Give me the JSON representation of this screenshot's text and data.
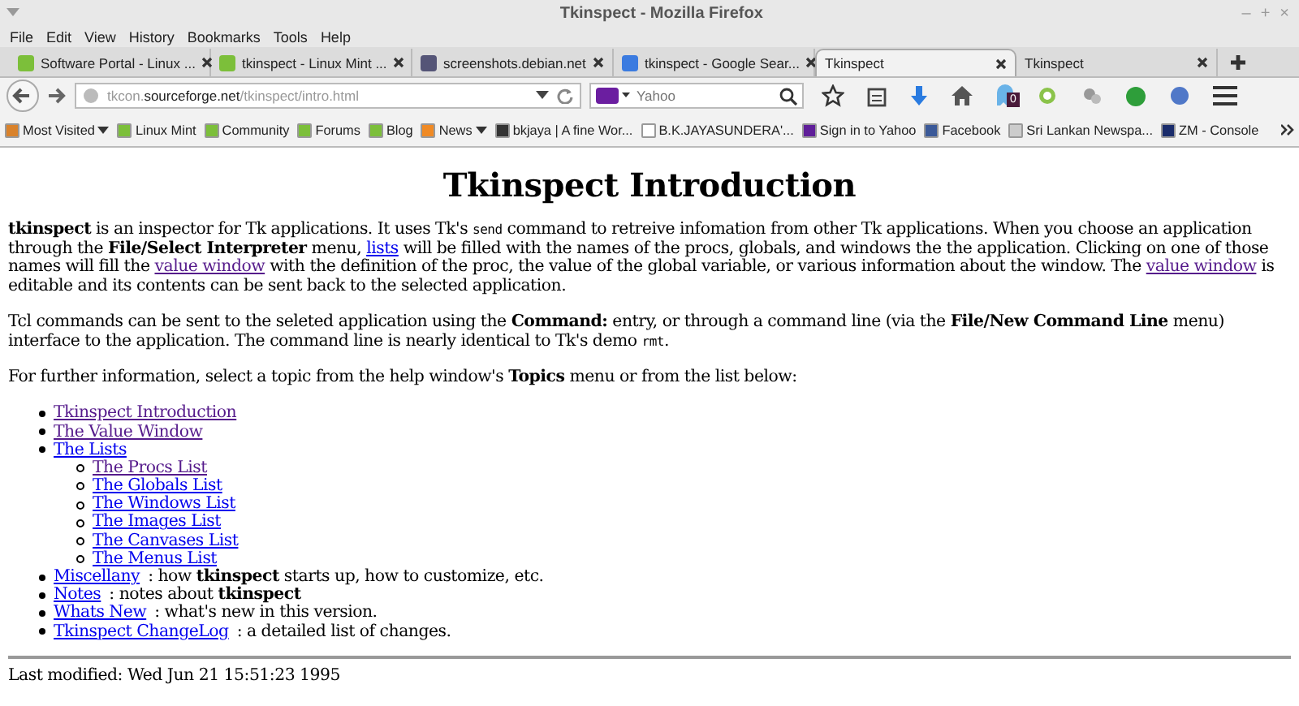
{
  "window": {
    "title": "Tkinspect - Mozilla Firefox",
    "controls": [
      "–",
      "+",
      "×"
    ]
  },
  "menu": [
    "File",
    "Edit",
    "View",
    "History",
    "Bookmarks",
    "Tools",
    "Help"
  ],
  "tabs": [
    {
      "label": "Software Portal - Linux ...",
      "kind": "mint",
      "selected": false
    },
    {
      "label": "tkinspect - Linux Mint ...",
      "kind": "mint",
      "selected": false
    },
    {
      "label": "screenshots.debian.net",
      "kind": "screen",
      "selected": false
    },
    {
      "label": "tkinspect - Google Sear...",
      "kind": "google",
      "selected": false
    },
    {
      "label": "Tkinspect",
      "kind": "plain",
      "selected": true
    },
    {
      "label": "Tkinspect",
      "kind": "plain",
      "selected": false
    }
  ],
  "address": {
    "parts": [
      {
        "text": "tkcon.",
        "emphasis": false
      },
      {
        "text": "sourceforge.net",
        "emphasis": true
      },
      {
        "text": "/tkinspect/intro.html",
        "emphasis": false
      }
    ]
  },
  "search": {
    "placeholder": "Yahoo"
  },
  "toolbar": {
    "badge": "0"
  },
  "bookmarks": [
    {
      "label": "Most Visited",
      "kind": "folder",
      "dropdown": true
    },
    {
      "label": "Linux Mint",
      "kind": "mint",
      "dropdown": false
    },
    {
      "label": "Community",
      "kind": "mint",
      "dropdown": false
    },
    {
      "label": "Forums",
      "kind": "mint",
      "dropdown": false
    },
    {
      "label": "Blog",
      "kind": "mint",
      "dropdown": false
    },
    {
      "label": "News",
      "kind": "rss",
      "dropdown": true
    },
    {
      "label": "bkjaya | A fine Wor...",
      "kind": "dark",
      "dropdown": false
    },
    {
      "label": "B.K.JAYASUNDERA'...",
      "kind": "page",
      "dropdown": false
    },
    {
      "label": "Sign in to Yahoo",
      "kind": "yahoo",
      "dropdown": false
    },
    {
      "label": "Facebook",
      "kind": "facebook",
      "dropdown": false
    },
    {
      "label": "Sri Lankan Newspa...",
      "kind": "news",
      "dropdown": false
    },
    {
      "label": "ZM - Console",
      "kind": "zm",
      "dropdown": false
    }
  ],
  "page": {
    "heading": "Tkinspect Introduction",
    "paragraphs": [
      [
        {
          "kind": "bold",
          "text": "tkinspect"
        },
        {
          "kind": "text",
          "text": " is an inspector for Tk applications. It uses Tk's "
        },
        {
          "kind": "code",
          "text": "send"
        },
        {
          "kind": "text",
          "text": " command to retreive infomation from other Tk applications. When you choose an application through the "
        },
        {
          "kind": "bold",
          "text": "File/Select Interpreter"
        },
        {
          "kind": "text",
          "text": " menu, "
        },
        {
          "kind": "link",
          "text": "lists",
          "visited": false
        },
        {
          "kind": "text",
          "text": " will be filled with the names of the procs, globals, and windows the the application. Clicking on one of those names will fill the "
        },
        {
          "kind": "link",
          "text": "value window",
          "visited": true
        },
        {
          "kind": "text",
          "text": " with the definition of the proc, the value of the global variable, or various information about the window. The "
        },
        {
          "kind": "link",
          "text": "value window",
          "visited": true
        },
        {
          "kind": "text",
          "text": " is editable and its contents can be sent back to the selected application."
        }
      ],
      [
        {
          "kind": "text",
          "text": "Tcl commands can be sent to the seleted application using the "
        },
        {
          "kind": "bold",
          "text": "Command:"
        },
        {
          "kind": "text",
          "text": " entry, or through a command line (via the "
        },
        {
          "kind": "bold",
          "text": "File/New Command Line"
        },
        {
          "kind": "text",
          "text": " menu) interface to the application. The command line is nearly identical to Tk's demo "
        },
        {
          "kind": "code",
          "text": "rmt"
        },
        {
          "kind": "text",
          "text": "."
        }
      ],
      [
        {
          "kind": "text",
          "text": "For further information, select a topic from the help window's "
        },
        {
          "kind": "bold",
          "text": "Topics"
        },
        {
          "kind": "text",
          "text": " menu or from the list below:"
        }
      ]
    ],
    "topics": [
      {
        "link": "Tkinspect Introduction",
        "visited": true
      },
      {
        "link": "The Value Window",
        "visited": true
      },
      {
        "link": "The Lists",
        "visited": false,
        "children": [
          {
            "link": "The Procs List",
            "visited": true
          },
          {
            "link": "The Globals List",
            "visited": false
          },
          {
            "link": "The Windows List",
            "visited": false
          },
          {
            "link": "The Images List",
            "visited": false
          },
          {
            "link": "The Canvases List",
            "visited": false
          },
          {
            "link": "The Menus List",
            "visited": false
          }
        ]
      },
      {
        "link": "Miscellany",
        "visited": false,
        "description": ": how **tkinspect** starts up, how to customize, etc."
      },
      {
        "link": "Notes",
        "visited": false,
        "description": ": notes about **tkinspect**"
      },
      {
        "link": "Whats New",
        "visited": false,
        "description": ": what's new in this version."
      },
      {
        "link": "Tkinspect ChangeLog",
        "visited": false,
        "description": ": a detailed list of changes."
      }
    ],
    "footer": "Last modified: Wed Jun 21 15:51:23 1995"
  }
}
